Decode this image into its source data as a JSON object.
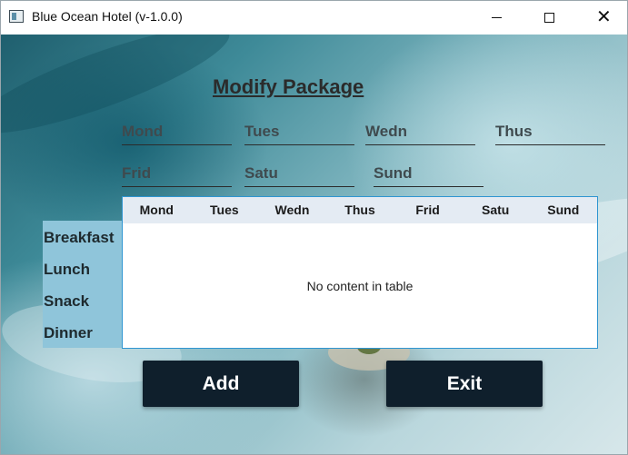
{
  "window": {
    "title": "Blue Ocean Hotel (v-1.0.0)",
    "minimize_icon": "minimize-icon",
    "maximize_icon": "maximize-icon",
    "close_icon": "close-icon",
    "close_glyph": "✕"
  },
  "page": {
    "heading": "Modify Package"
  },
  "fields": {
    "mond": {
      "placeholder": "Mond",
      "value": ""
    },
    "tues": {
      "placeholder": "Tues",
      "value": ""
    },
    "wedn": {
      "placeholder": "Wedn",
      "value": ""
    },
    "thus": {
      "placeholder": "Thus",
      "value": ""
    },
    "frid": {
      "placeholder": "Frid",
      "value": ""
    },
    "satu": {
      "placeholder": "Satu",
      "value": ""
    },
    "sund": {
      "placeholder": "Sund",
      "value": ""
    }
  },
  "meals": [
    "Breakfast",
    "Lunch",
    "Snack",
    "Dinner"
  ],
  "table": {
    "columns": [
      "Mond",
      "Tues",
      "Wedn",
      "Thus",
      "Frid",
      "Satu",
      "Sund"
    ],
    "rows": [],
    "empty_text": "No content in table"
  },
  "buttons": {
    "add": "Add",
    "exit": "Exit"
  },
  "colors": {
    "button_bg": "#0f1f2c",
    "table_border": "#2f95d1",
    "header_bg": "#e4ebf3",
    "meals_bg": "#8fc5da"
  }
}
